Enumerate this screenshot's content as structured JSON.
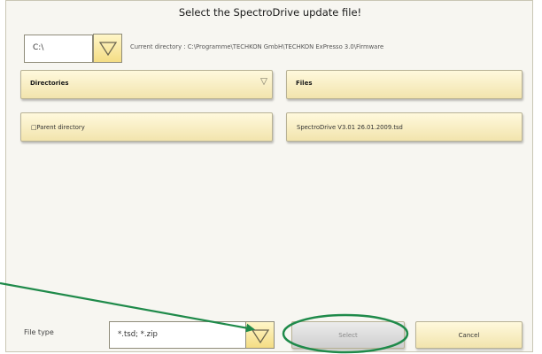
{
  "dialog": {
    "title": "Select the SpectroDrive update file!",
    "drive_value": "C:\\",
    "current_directory_text": "Current directory : C:\\Programme\\TECHKON GmbH\\TECHKON ExPresso 3.0\\Firmware"
  },
  "directories": {
    "header": "Directories",
    "items": [
      "□Parent directory"
    ]
  },
  "files": {
    "header": "Files",
    "items": [
      "SpectroDrive V3.01 26.01.2009.tsd"
    ]
  },
  "footer": {
    "file_type_label": "File type",
    "file_type_value": "*.tsd; *.zip",
    "select_label": "Select",
    "cancel_label": "Cancel"
  },
  "colors": {
    "panel": "#f6ecc0",
    "annotation": "#1f8a4a",
    "disabled_button": "#dcdcdc"
  },
  "icons": [
    "triangle-down-icon",
    "chevron-down-icon",
    "annotation-arrow-icon"
  ]
}
